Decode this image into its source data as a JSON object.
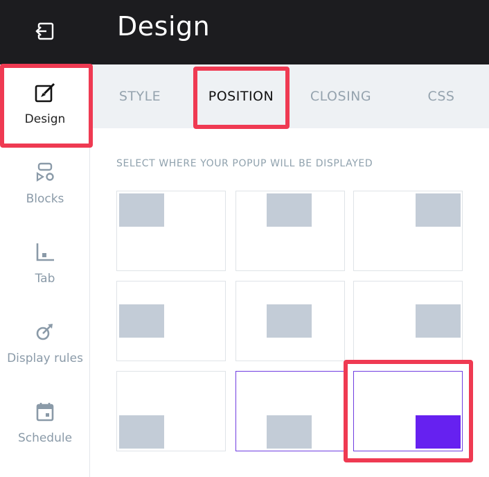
{
  "header": {
    "title": "Design",
    "back_icon": "exit-arrow-icon"
  },
  "sidebar": {
    "items": [
      {
        "label": "Design",
        "icon": "paintbrush-icon",
        "active": true
      },
      {
        "label": "Blocks",
        "icon": "blocks-icon",
        "active": false
      },
      {
        "label": "Tab",
        "icon": "tab-icon",
        "active": false
      },
      {
        "label": "Display rules",
        "icon": "display-rules-icon",
        "active": false
      },
      {
        "label": "Schedule",
        "icon": "calendar-icon",
        "active": false
      }
    ]
  },
  "tabs": [
    {
      "label": "STYLE",
      "active": false
    },
    {
      "label": "POSITION",
      "active": true
    },
    {
      "label": "CLOSING",
      "active": false
    },
    {
      "label": "CSS",
      "active": false
    }
  ],
  "position": {
    "section_label": "SELECT WHERE YOUR POPUP WILL BE DISPLAYED",
    "options": [
      "top-left",
      "top-center",
      "top-right",
      "middle-left",
      "middle-center",
      "middle-right",
      "bottom-left",
      "bottom-center",
      "bottom-right"
    ],
    "selected": "bottom-right"
  },
  "colors": {
    "topbar": "#1c1c1f",
    "accent": "#6621f0",
    "highlight": "#ef3a52",
    "placeholder": "#c3ccd7"
  }
}
